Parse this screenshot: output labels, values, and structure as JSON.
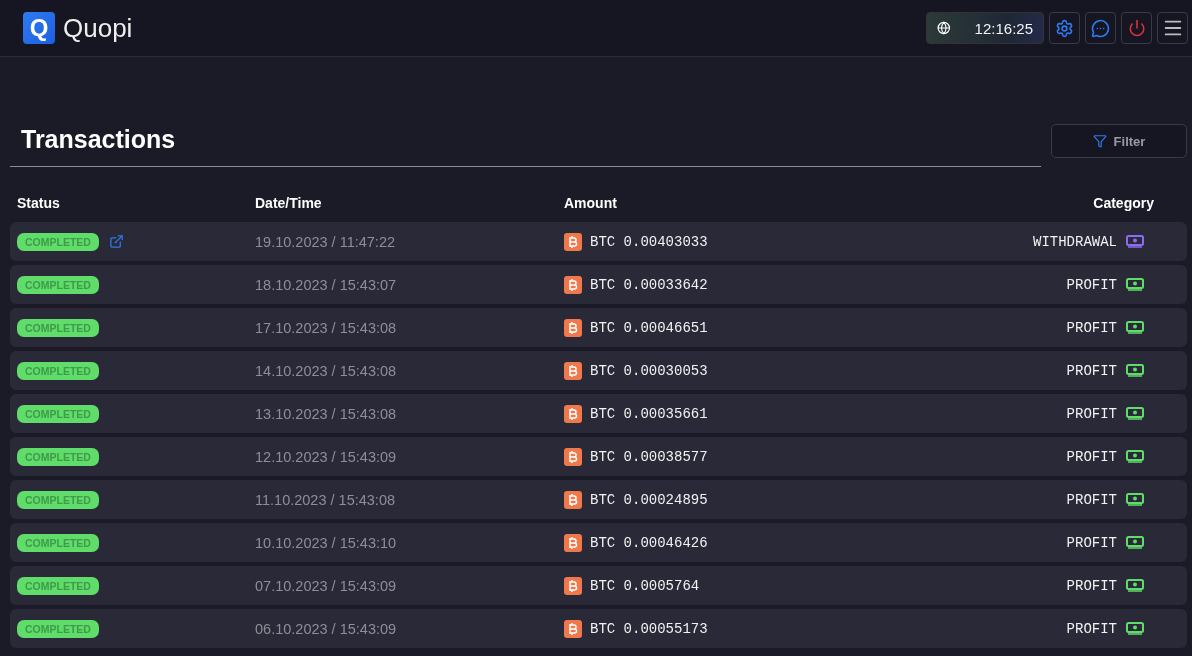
{
  "brand": {
    "name": "Quopi",
    "logo_letter": "Q"
  },
  "clock": {
    "time": "12:16:25"
  },
  "page": {
    "title": "Transactions",
    "filter_label": "Filter"
  },
  "columns": [
    "Status",
    "Date/Time",
    "Amount",
    "Category"
  ],
  "rows": [
    {
      "status": "COMPLETED",
      "link": true,
      "datetime": "19.10.2023 / 11:47:22",
      "amount": "BTC 0.00403033",
      "category": "WITHDRAWAL",
      "kind": "withdrawal"
    },
    {
      "status": "COMPLETED",
      "link": false,
      "datetime": "18.10.2023 / 15:43:07",
      "amount": "BTC 0.00033642",
      "category": "PROFIT",
      "kind": "profit"
    },
    {
      "status": "COMPLETED",
      "link": false,
      "datetime": "17.10.2023 / 15:43:08",
      "amount": "BTC 0.00046651",
      "category": "PROFIT",
      "kind": "profit"
    },
    {
      "status": "COMPLETED",
      "link": false,
      "datetime": "14.10.2023 / 15:43:08",
      "amount": "BTC 0.00030053",
      "category": "PROFIT",
      "kind": "profit"
    },
    {
      "status": "COMPLETED",
      "link": false,
      "datetime": "13.10.2023 / 15:43:08",
      "amount": "BTC 0.00035661",
      "category": "PROFIT",
      "kind": "profit"
    },
    {
      "status": "COMPLETED",
      "link": false,
      "datetime": "12.10.2023 / 15:43:09",
      "amount": "BTC 0.00038577",
      "category": "PROFIT",
      "kind": "profit"
    },
    {
      "status": "COMPLETED",
      "link": false,
      "datetime": "11.10.2023 / 15:43:08",
      "amount": "BTC 0.00024895",
      "category": "PROFIT",
      "kind": "profit"
    },
    {
      "status": "COMPLETED",
      "link": false,
      "datetime": "10.10.2023 / 15:43:10",
      "amount": "BTC 0.00046426",
      "category": "PROFIT",
      "kind": "profit"
    },
    {
      "status": "COMPLETED",
      "link": false,
      "datetime": "07.10.2023 / 15:43:09",
      "amount": "BTC 0.0005764",
      "category": "PROFIT",
      "kind": "profit"
    },
    {
      "status": "COMPLETED",
      "link": false,
      "datetime": "06.10.2023 / 15:43:09",
      "amount": "BTC 0.00055173",
      "category": "PROFIT",
      "kind": "profit"
    }
  ]
}
